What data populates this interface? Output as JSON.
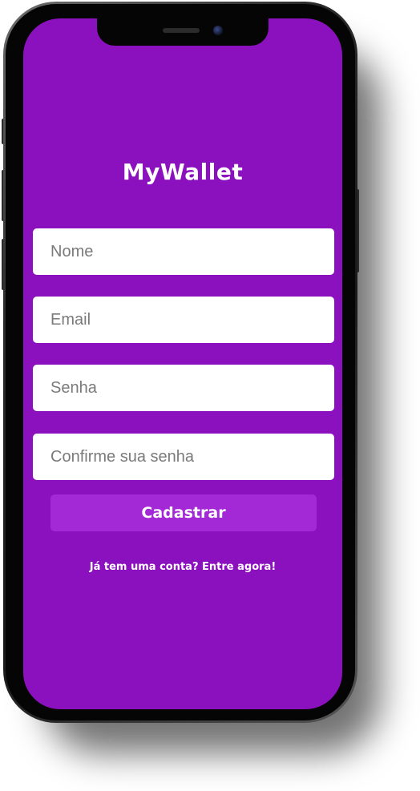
{
  "app": {
    "logo": "MyWallet"
  },
  "form": {
    "name_placeholder": "Nome",
    "email_placeholder": "Email",
    "password_placeholder": "Senha",
    "confirm_placeholder": "Confirme sua senha",
    "submit_label": "Cadastrar"
  },
  "footer": {
    "login_link": "Já tem uma conta? Entre agora!"
  },
  "colors": {
    "background": "#8c11be",
    "button": "#a328d6",
    "text": "#ffffff"
  }
}
